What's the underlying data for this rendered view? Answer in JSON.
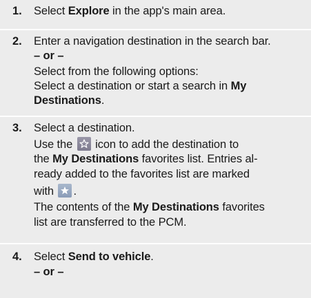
{
  "steps": [
    {
      "number": "1.",
      "lines": [
        {
          "a": "Select ",
          "b": "Explore",
          "c": " in the app's main area."
        }
      ]
    },
    {
      "number": "2.",
      "lines": [
        {
          "a": "Enter a navigation destination in the search bar."
        },
        {
          "b": "– or –"
        },
        {
          "a": "Select from the following options:"
        },
        {
          "a": "Select a destination or start a search in ",
          "b": "My"
        },
        {
          "b": "Destinations",
          "c": "."
        }
      ]
    },
    {
      "number": "3.",
      "lines": [
        {
          "a": "Select a destination."
        },
        {
          "a": "Use the ",
          "icon": "star-outline-icon",
          "c": " icon to add the destination to"
        },
        {
          "a": "the ",
          "b": "My Destinations",
          "c": " favorites list. Entries al-"
        },
        {
          "a": "ready added to the favorites list are marked"
        },
        {
          "a": "with ",
          "icon": "star-filled-icon",
          "c": "."
        },
        {
          "a": "The contents of the ",
          "b": "My Destinations",
          "c": " favorites"
        },
        {
          "a": "list are transferred to the PCM."
        }
      ]
    },
    {
      "number": "4.",
      "lines": [
        {
          "a": "Select ",
          "b": "Send to vehicle",
          "c": "."
        },
        {
          "b": "– or –"
        }
      ]
    }
  ]
}
